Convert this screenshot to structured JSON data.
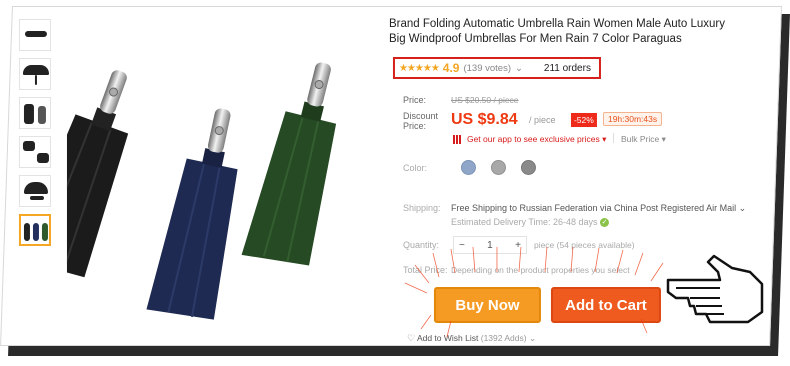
{
  "product": {
    "title": "Brand Folding Automatic Umbrella Rain Women Male Auto Luxury Big Windproof Umbrellas For Men Rain 7 Color Paraguas",
    "stars": "★★★★★",
    "rating": "4.9",
    "votes": "(139 votes)",
    "votes_chevron": "⌄",
    "orders": "211 orders"
  },
  "pricing": {
    "price_label": "Price:",
    "old_price": "US $20.50 / piece",
    "discount_label_line1": "Discount",
    "discount_label_line2": "Price:",
    "price": "US $9.84",
    "per_piece": "/ piece",
    "discount": "-52%",
    "timer": "19h:30m:43s",
    "app_link": "Get our app to see exclusive prices ▾",
    "bulk_price": "Bulk Price ▾"
  },
  "color": {
    "label": "Color:",
    "swatches": [
      "#8fa6c9",
      "#a8a8a8",
      "#8a8a8a"
    ]
  },
  "shipping": {
    "label": "Shipping:",
    "text": "Free Shipping to Russian Federation via China Post Registered Air Mail ⌄",
    "delivery": "Estimated Delivery Time: 26-48 days"
  },
  "quantity": {
    "label": "Quantity:",
    "minus": "−",
    "value": "1",
    "plus": "+",
    "note": "piece (54 pieces available)"
  },
  "total": {
    "label": "Total Price:",
    "note": "Depending on the product properties you select"
  },
  "actions": {
    "buy_now": "Buy Now",
    "add_to_cart": "Add to Cart",
    "wishlist": "Add to Wish List",
    "wishlist_count": "(1392 Adds)",
    "wishlist_chevron": "⌄"
  },
  "colors": {
    "accent": "#f5a623",
    "price_red": "#ee3a12",
    "highlight_border": "#d6201b",
    "buy_now": "#f59a23",
    "add_to_cart": "#ef5a1f"
  }
}
